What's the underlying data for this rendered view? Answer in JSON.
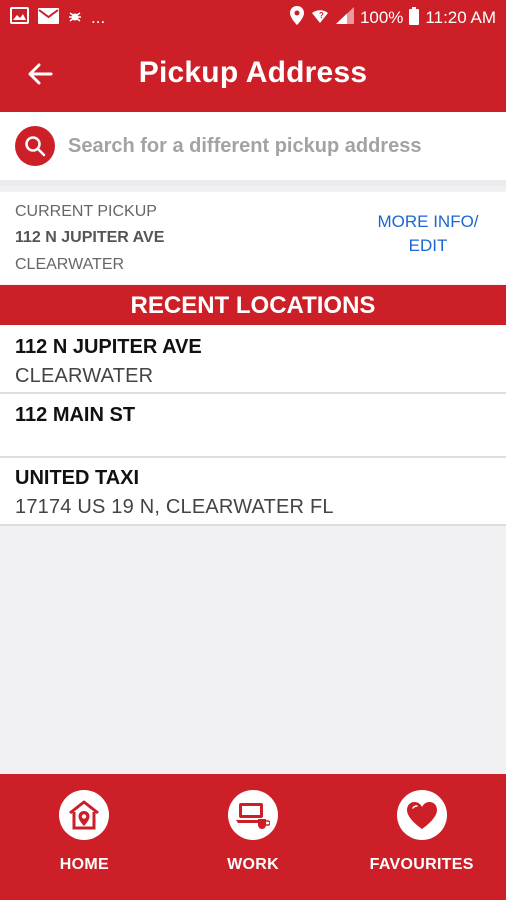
{
  "status_bar": {
    "icons_left": [
      "image-icon",
      "mail-icon",
      "bug-icon"
    ],
    "overflow": "...",
    "battery": "100%",
    "time": "11:20 AM"
  },
  "app_bar": {
    "title": "Pickup Address"
  },
  "search": {
    "placeholder": "Search for a different pickup address"
  },
  "current_pickup": {
    "label": "CURRENT PICKUP",
    "address": "112 N JUPITER AVE",
    "city": "CLEARWATER",
    "more_info_line1": "MORE INFO/",
    "more_info_line2": "EDIT"
  },
  "recent": {
    "header": "RECENT LOCATIONS",
    "items": [
      {
        "title": "112 N JUPITER AVE",
        "subtitle": "CLEARWATER"
      },
      {
        "title": "112 MAIN ST",
        "subtitle": ""
      },
      {
        "title": "UNITED TAXI",
        "subtitle": "17174 US 19 N, CLEARWATER  FL"
      }
    ]
  },
  "bottom_nav": [
    {
      "label": "HOME",
      "icon": "home-pin-icon"
    },
    {
      "label": "WORK",
      "icon": "laptop-coffee-icon"
    },
    {
      "label": "FAVOURITES",
      "icon": "heart-icon"
    }
  ],
  "colors": {
    "brand_red": "#cc1f27",
    "link_blue": "#1b66d4",
    "background": "#f1f1f3"
  }
}
